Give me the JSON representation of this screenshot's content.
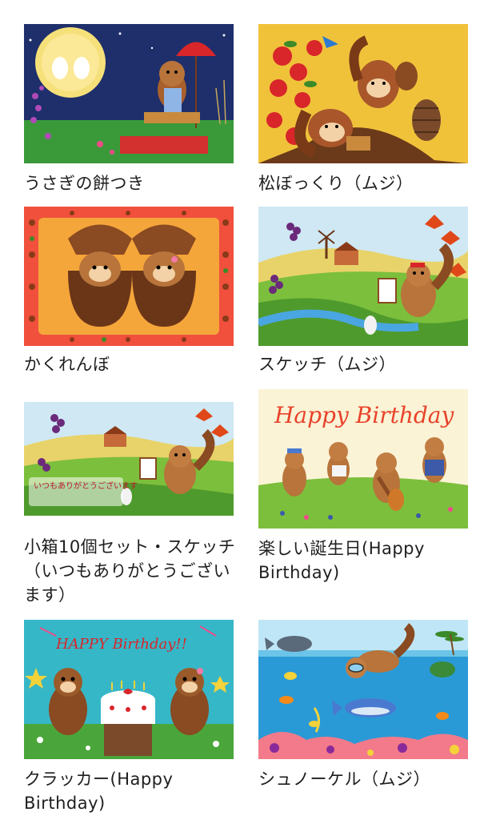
{
  "products": [
    {
      "title": "うさぎの餅つき",
      "image": "moon-rabbits-mochi-illustration"
    },
    {
      "title": "松ぼっくり（ムジ）",
      "image": "squirrels-pinecone-apples-illustration"
    },
    {
      "title": "かくれんぼ",
      "image": "squirrels-acorn-hide-and-seek-illustration"
    },
    {
      "title": "スケッチ（ムジ）",
      "image": "squirrel-painting-landscape-illustration"
    },
    {
      "title": "小箱10個セット・スケッチ（いつもありがとうございます）",
      "image": "squirrel-sketch-thank-you-illustration",
      "lettering": "いつもありがとうございます"
    },
    {
      "title": "楽しい誕生日(Happy Birthday)",
      "image": "squirrel-band-birthday-illustration",
      "lettering": "Happy Birthday"
    },
    {
      "title": "クラッカー(Happy Birthday)",
      "image": "squirrels-birthday-cake-illustration",
      "lettering": "HAPPY Birthday!!"
    },
    {
      "title": "シュノーケル（ムジ）",
      "image": "squirrel-snorkel-underwater-illustration"
    }
  ],
  "colors": {
    "text": "#1e1e1e",
    "background": "#ffffff"
  }
}
